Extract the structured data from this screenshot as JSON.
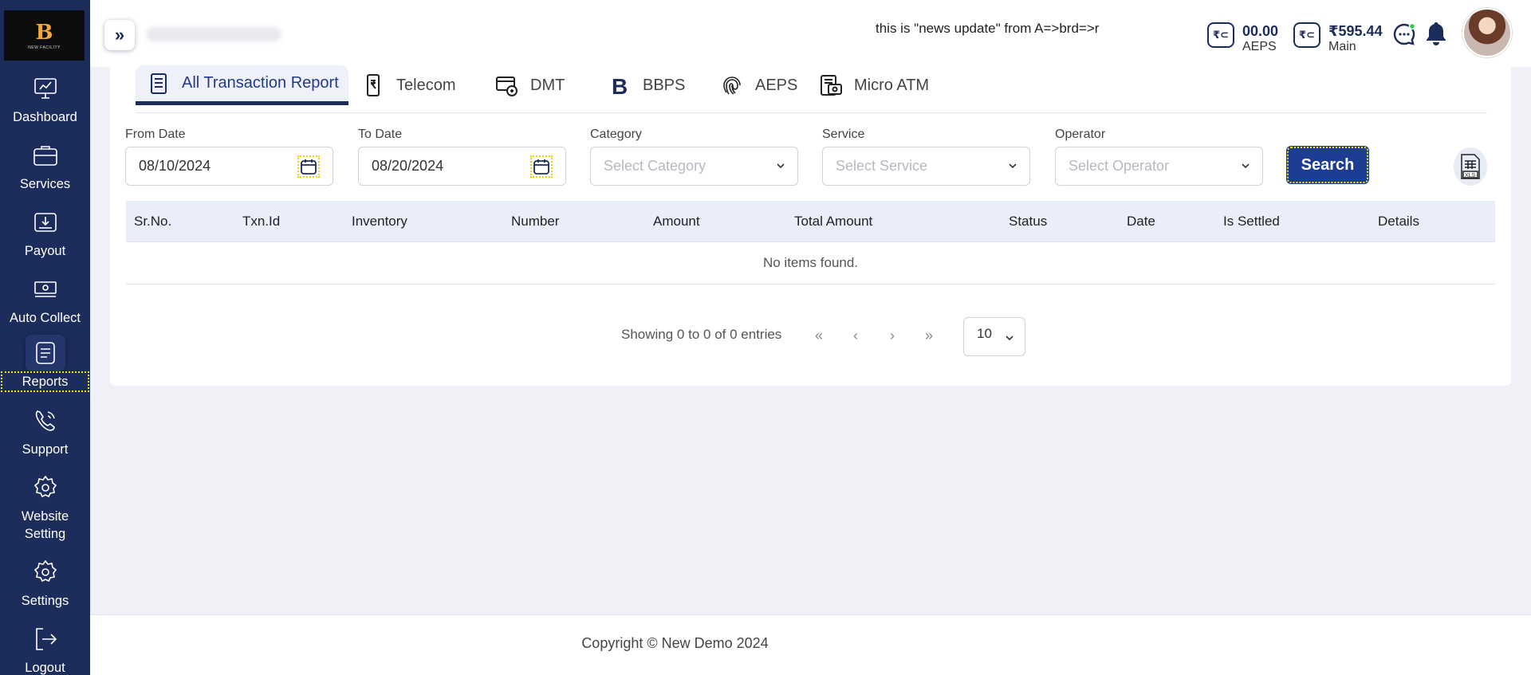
{
  "brand": {
    "logo_mark": "B",
    "logo_sub": "NEW FACILITY"
  },
  "sidebar": {
    "items": [
      {
        "label": "Dashboard",
        "icon": "dashboard-icon"
      },
      {
        "label": "Services",
        "icon": "briefcase-icon"
      },
      {
        "label": "Payout",
        "icon": "payout-icon"
      },
      {
        "label": "Auto Collect",
        "icon": "cash-icon"
      },
      {
        "label": "Reports",
        "icon": "reports-icon",
        "active": true
      },
      {
        "label": "Support",
        "icon": "phone-icon"
      },
      {
        "label": "Website Setting",
        "icon": "gear-icon"
      },
      {
        "label": "Settings",
        "icon": "gear-icon"
      },
      {
        "label": "Logout",
        "icon": "logout-icon"
      }
    ]
  },
  "header": {
    "toggle_label": "»",
    "news": "this is \"news update\" from A=>brd=>r",
    "wallets": [
      {
        "icon_text": "₹⊂",
        "amount": "00.00",
        "label": "AEPS"
      },
      {
        "icon_text": "₹⊂",
        "amount": "₹595.44",
        "label": "Main"
      }
    ]
  },
  "tabs": [
    {
      "label": "All Transaction Report",
      "icon": "report-list-icon",
      "active": true
    },
    {
      "label": "Telecom",
      "icon": "mobile-rupee-icon"
    },
    {
      "label": "DMT",
      "icon": "dmt-icon"
    },
    {
      "label": "BBPS",
      "icon": "bbps-icon"
    },
    {
      "label": "AEPS",
      "icon": "fingerprint-icon"
    },
    {
      "label": "Micro ATM",
      "icon": "micro-atm-icon"
    }
  ],
  "filters": {
    "from_date": {
      "label": "From Date",
      "value": "08/10/2024"
    },
    "to_date": {
      "label": "To Date",
      "value": "08/20/2024"
    },
    "category": {
      "label": "Category",
      "placeholder": "Select Category"
    },
    "service": {
      "label": "Service",
      "placeholder": "Select Service"
    },
    "operator": {
      "label": "Operator",
      "placeholder": "Select Operator"
    },
    "search_label": "Search"
  },
  "table": {
    "columns": [
      "Sr.No.",
      "Txn.Id",
      "Inventory",
      "Number",
      "Amount",
      "Total Amount",
      "Status",
      "Date",
      "Is Settled",
      "Details"
    ],
    "empty_text": "No items found."
  },
  "pagination": {
    "summary": "Showing 0 to 0 of 0 entries",
    "first": "«",
    "prev": "‹",
    "next": "›",
    "last": "»",
    "page_size": "10"
  },
  "footer": {
    "text": "Copyright © New Demo 2024"
  },
  "colors": {
    "sidebar": "#1c2c5b",
    "accent": "#1c3d91",
    "background": "#f0f1f6"
  }
}
